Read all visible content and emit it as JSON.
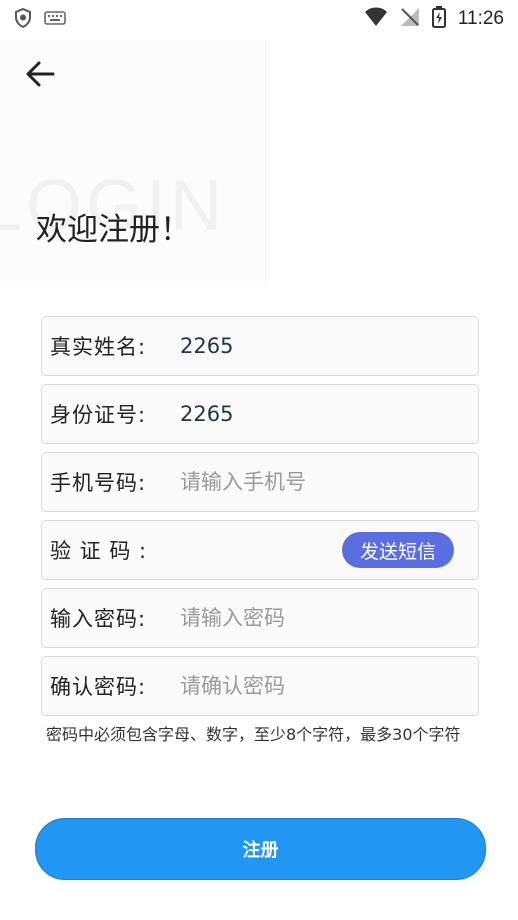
{
  "status_bar": {
    "time": "11:26",
    "icons": [
      "shield-icon",
      "keyboard-icon",
      "wifi-icon",
      "no-signal-icon",
      "battery-charging-icon"
    ]
  },
  "header": {
    "back_icon": "arrow-left-icon",
    "watermark": "LOGIN",
    "welcome": "欢迎注册！"
  },
  "form": {
    "fields": [
      {
        "label": "真实姓名:",
        "value": "2265",
        "placeholder": ""
      },
      {
        "label": "身份证号:",
        "value": "2265",
        "placeholder": ""
      },
      {
        "label": "手机号码:",
        "value": "",
        "placeholder": "请输入手机号"
      },
      {
        "label": "验 证 码 :",
        "value": "",
        "placeholder": ""
      },
      {
        "label": "输入密码:",
        "value": "",
        "placeholder": "请输入密码"
      },
      {
        "label": "确认密码:",
        "value": "",
        "placeholder": "请确认密码"
      }
    ],
    "sms_button": "发送短信",
    "hint": "密码中必须包含字母、数字，至少8个字符，最多30个字符",
    "submit": "注册"
  },
  "colors": {
    "primary": "#2196f3",
    "sms_button": "#5b6ee1"
  }
}
